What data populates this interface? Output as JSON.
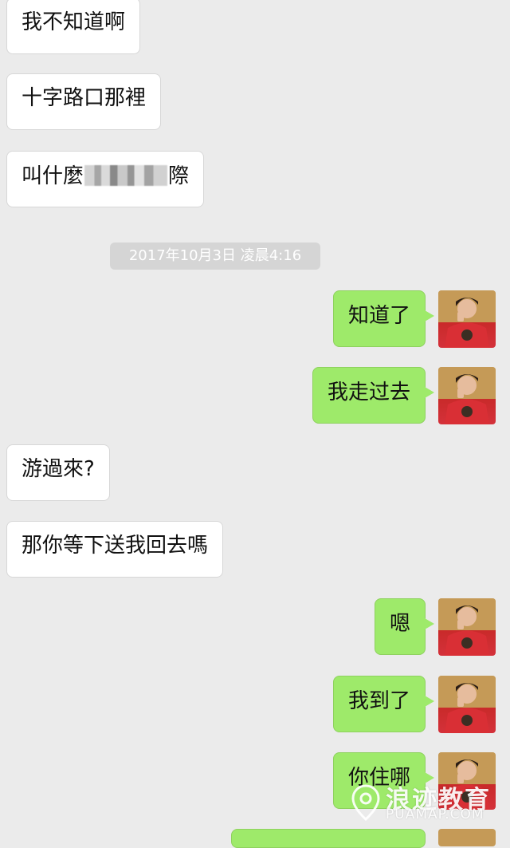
{
  "colors": {
    "chat_background": "#ebebeb",
    "received_bubble": "#ffffff",
    "sent_bubble": "#9eea6a",
    "timestamp_background": "#d5d5d5"
  },
  "messages": {
    "m1": "我不知道啊",
    "m2": "十字路口那裡",
    "m3_prefix": "叫什麼",
    "m3_suffix": "際",
    "timestamp": "2017年10月3日 凌晨4:16",
    "m4": "知道了",
    "m5": "我走过去",
    "m6": "游過來?",
    "m7": "那你等下送我回去嗎",
    "m8": "嗯",
    "m9": "我到了",
    "m10": "你住哪"
  },
  "watermark": {
    "brand": "浪迹教育",
    "domain": "PUAMAP.COM",
    "icon": "location-pin-icon"
  },
  "icons": {
    "avatar": "avatar-image-icon",
    "censor": "mosaic-blur"
  }
}
